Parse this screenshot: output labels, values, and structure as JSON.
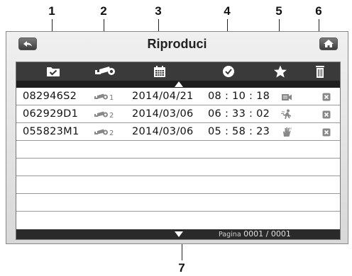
{
  "callouts": [
    "1",
    "2",
    "3",
    "4",
    "5",
    "6",
    "7"
  ],
  "header": {
    "title": "Riproduci"
  },
  "icons": [
    "back-arrow-icon",
    "home-icon",
    "folder-check-icon",
    "camera-icon",
    "calendar-icon",
    "clock-icon",
    "star-icon",
    "trash-icon",
    "up-arrow-icon",
    "down-arrow-icon",
    "video-record-icon",
    "motion-person-icon",
    "manual-hand-icon",
    "delete-x-icon"
  ],
  "recordings": [
    {
      "file": "082946S2",
      "camera": "1",
      "date": "2014/04/21",
      "time": "08 : 10 : 18",
      "type": "video-record-icon"
    },
    {
      "file": "062929D1",
      "camera": "2",
      "date": "2014/03/06",
      "time": "06 : 33 : 02",
      "type": "motion-person-icon"
    },
    {
      "file": "055823M1",
      "camera": "2",
      "date": "2014/03/06",
      "time": "05 : 58 : 23",
      "type": "manual-hand-icon"
    }
  ],
  "footer": {
    "pagina_label": "Pagina",
    "page_value": "0001 / 0001"
  },
  "colors": {
    "toolbar": "#3a3a3a",
    "icon": "#ffffff",
    "row_icon": "#888888",
    "divider": "#9a9a9a"
  }
}
